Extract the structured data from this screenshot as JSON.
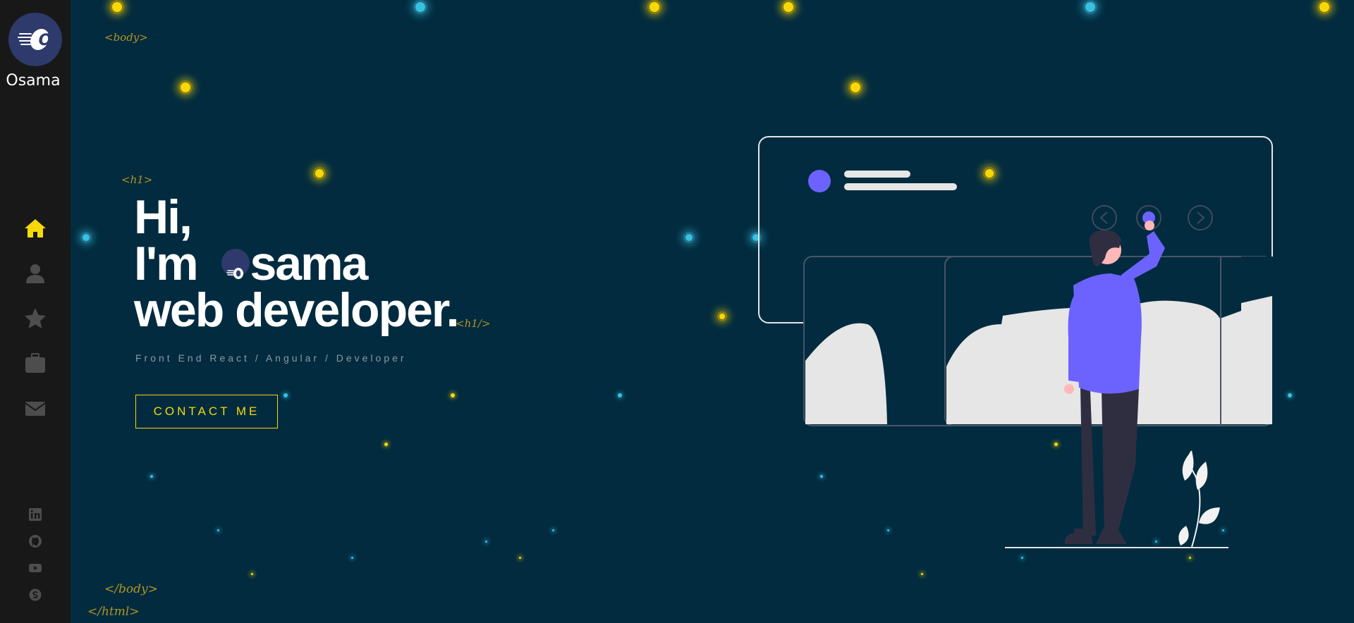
{
  "brand": {
    "name": "Osama",
    "logo_letter": "O"
  },
  "nav": [
    {
      "id": "home",
      "icon": "home-icon",
      "active": true
    },
    {
      "id": "about",
      "icon": "user-icon",
      "active": false
    },
    {
      "id": "skills",
      "icon": "star-icon",
      "active": false
    },
    {
      "id": "portfolio",
      "icon": "briefcase-icon",
      "active": false
    },
    {
      "id": "contact",
      "icon": "envelope-icon",
      "active": false
    }
  ],
  "social": [
    "linkedin-icon",
    "github-icon",
    "youtube-icon",
    "skype-icon"
  ],
  "tags": {
    "body_open": "<body>",
    "h1_open": "<h1>",
    "h1_close": "<h1/>",
    "body_close": "</body>",
    "html_close": "</html>"
  },
  "hero": {
    "line1": "Hi,",
    "line2_prefix": "I'm",
    "line2_name": "sama",
    "line3": "web developer.",
    "subtitle": "Front End React / Angular / Developer",
    "cta": "CONTACT ME"
  },
  "colors": {
    "background": "#022b3f",
    "sidebar": "#181818",
    "accent": "#f5d90a",
    "illustration_accent": "#6c63ff"
  }
}
